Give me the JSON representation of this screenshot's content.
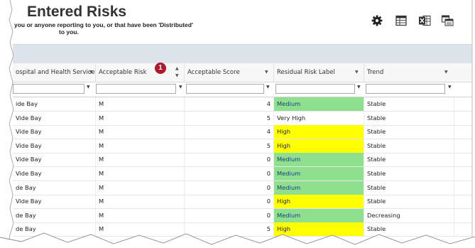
{
  "header": {
    "title": "Entered Risks",
    "subtitle_line1": "you or anyone reporting to you, or that have been 'Distributed'",
    "subtitle_line2": "to you."
  },
  "toolbar": {
    "buttons": [
      {
        "name": "settings-button",
        "icon": "gear-icon"
      },
      {
        "name": "grid-view-button",
        "icon": "table-icon"
      },
      {
        "name": "export-excel-button",
        "icon": "excel-icon"
      },
      {
        "name": "layout-button",
        "icon": "window-layout-icon"
      }
    ]
  },
  "badge": {
    "label": "1",
    "color": "#b2182b"
  },
  "columns": [
    {
      "label": "ospital and Health Service"
    },
    {
      "label": "Acceptable Risk"
    },
    {
      "label": "Acceptable Score"
    },
    {
      "label": "Residual Risk Label"
    },
    {
      "label": "Trend"
    }
  ],
  "colors": {
    "medium": "#8ee08e",
    "high": "#ffff00"
  },
  "rows": [
    {
      "service": "ide Bay",
      "acceptable_risk": "M",
      "acceptable_score": "4",
      "residual_label": "Medium",
      "residual_level": "medium",
      "trend": "Stable"
    },
    {
      "service": "Vide Bay",
      "acceptable_risk": "M",
      "acceptable_score": "5",
      "residual_label": "Very High",
      "residual_level": "none",
      "trend": "Stable"
    },
    {
      "service": "Vide Bay",
      "acceptable_risk": "M",
      "acceptable_score": "4",
      "residual_label": "High",
      "residual_level": "high",
      "trend": "Stable"
    },
    {
      "service": "Vide Bay",
      "acceptable_risk": "M",
      "acceptable_score": "5",
      "residual_label": "High",
      "residual_level": "high",
      "trend": "Stable"
    },
    {
      "service": "Vide Bay",
      "acceptable_risk": "M",
      "acceptable_score": "0",
      "residual_label": "Medium",
      "residual_level": "medium",
      "trend": "Stable"
    },
    {
      "service": "Vide Bay",
      "acceptable_risk": "M",
      "acceptable_score": "0",
      "residual_label": "Medium",
      "residual_level": "medium",
      "trend": "Stable"
    },
    {
      "service": "de Bay",
      "acceptable_risk": "M",
      "acceptable_score": "0",
      "residual_label": "Medium",
      "residual_level": "medium",
      "trend": "Stable"
    },
    {
      "service": "Vide Bay",
      "acceptable_risk": "M",
      "acceptable_score": "0",
      "residual_label": "High",
      "residual_level": "high",
      "trend": "Stable"
    },
    {
      "service": "de Bay",
      "acceptable_risk": "M",
      "acceptable_score": "0",
      "residual_label": "Medium",
      "residual_level": "medium",
      "trend": "Decreasing"
    },
    {
      "service": "de Bay",
      "acceptable_risk": "M",
      "acceptable_score": "5",
      "residual_label": "High",
      "residual_level": "high",
      "trend": "Stable"
    }
  ]
}
